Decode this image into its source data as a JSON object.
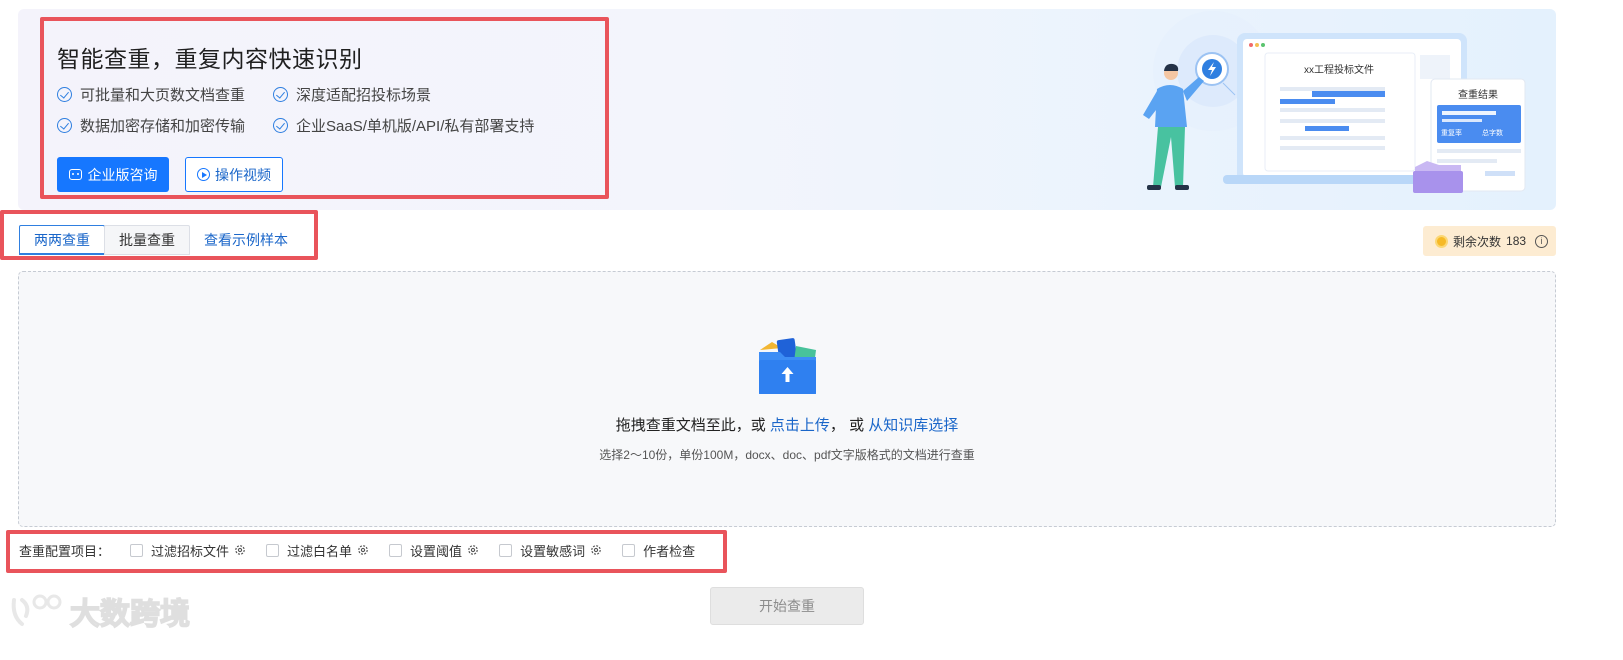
{
  "hero": {
    "title": "智能查重，重复内容快速识别",
    "features": [
      "可批量和大页数文档查重",
      "深度适配招投标场景",
      "数据加密存储和加密传输",
      "企业SaaS/单机版/API/私有部署支持"
    ],
    "consult_button": "企业版咨询",
    "video_button": "操作视频",
    "illustration": {
      "doc_title": "xx工程投标文件",
      "result_title": "查重结果",
      "result_label_1": "重复率",
      "result_label_2": "总字数"
    }
  },
  "tabs": {
    "pairwise": "两两查重",
    "batch": "批量查重",
    "sample_link": "查看示例样本"
  },
  "remaining": {
    "label": "剩余次数",
    "count": "183"
  },
  "upload": {
    "prompt_prefix": "拖拽查重文档至此，或 ",
    "click_upload": "点击上传",
    "prompt_mid": "， 或 ",
    "from_library": "从知识库选择",
    "hint": "选择2～10份，单份100M，docx、doc、pdf文字版格式的文档进行查重"
  },
  "config": {
    "label": "查重配置项目：",
    "options": [
      {
        "label": "过滤招标文件",
        "has_settings": true
      },
      {
        "label": "过滤白名单",
        "has_settings": true
      },
      {
        "label": "设置阈值",
        "has_settings": true
      },
      {
        "label": "设置敏感词",
        "has_settings": true
      },
      {
        "label": "作者检查",
        "has_settings": false
      }
    ]
  },
  "start_button": "开始查重",
  "watermark": "大数跨境",
  "colors": {
    "primary": "#1677ff",
    "highlight_box": "#e9545b",
    "remaining_bg": "#fdecd2"
  }
}
